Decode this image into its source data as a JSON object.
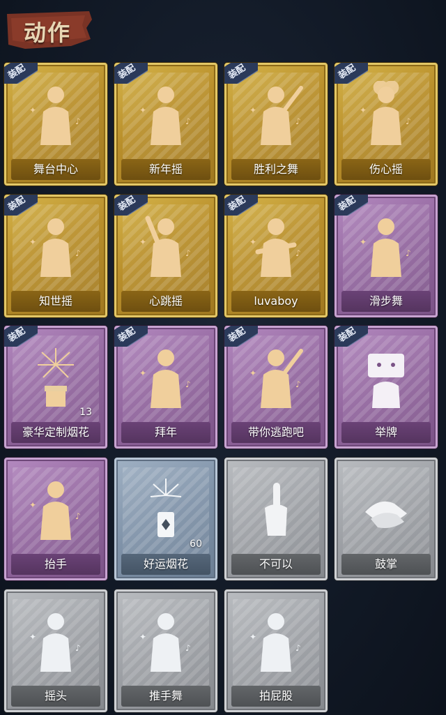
{
  "header": {
    "title": "动作"
  },
  "badge_text": "装配",
  "colors": {
    "gold": "#c9a23d",
    "purple": "#9a6fa6",
    "blue": "#8597ad",
    "gray": "#a2a5aa",
    "badge": "#2b3a5a",
    "background": "#151d2a"
  },
  "cards": [
    {
      "label": "舞台中心",
      "rarity": "gold",
      "equipped": true,
      "icon": "pose-hand-on-chest-icon"
    },
    {
      "label": "新年摇",
      "rarity": "gold",
      "equipped": true,
      "icon": "pose-shake-icon"
    },
    {
      "label": "胜利之舞",
      "rarity": "gold",
      "equipped": true,
      "icon": "pose-victory-dance-icon"
    },
    {
      "label": "伤心摇",
      "rarity": "gold",
      "equipped": true,
      "icon": "pose-heart-arms-icon"
    },
    {
      "label": "知世摇",
      "rarity": "gold",
      "equipped": true,
      "icon": "pose-arm-wave-icon"
    },
    {
      "label": "心跳摇",
      "rarity": "gold",
      "equipped": true,
      "icon": "pose-hand-raise-icon"
    },
    {
      "label": "luvaboy",
      "rarity": "gold",
      "equipped": true,
      "icon": "pose-cross-arms-icon"
    },
    {
      "label": "滑步舞",
      "rarity": "purple",
      "equipped": true,
      "icon": "pose-slide-icon"
    },
    {
      "label": "豪华定制烟花",
      "rarity": "purple",
      "equipped": true,
      "icon": "fireworks-box-icon",
      "count": "13"
    },
    {
      "label": "拜年",
      "rarity": "purple",
      "equipped": true,
      "icon": "pose-greeting-icon"
    },
    {
      "label": "带你逃跑吧",
      "rarity": "purple",
      "equipped": true,
      "icon": "pose-run-icon"
    },
    {
      "label": "举牌",
      "rarity": "purple",
      "equipped": true,
      "icon": "pose-hold-sign-icon"
    },
    {
      "label": "抬手",
      "rarity": "purple",
      "equipped": false,
      "icon": "pose-raise-hand-icon"
    },
    {
      "label": "好运烟花",
      "rarity": "blue",
      "equipped": false,
      "icon": "firecracker-icon",
      "count": "60"
    },
    {
      "label": "不可以",
      "rarity": "gray",
      "equipped": false,
      "icon": "finger-wag-icon"
    },
    {
      "label": "鼓掌",
      "rarity": "gray",
      "equipped": false,
      "icon": "clap-icon"
    },
    {
      "label": "摇头",
      "rarity": "gray",
      "equipped": false,
      "icon": "pose-head-shake-icon"
    },
    {
      "label": "推手舞",
      "rarity": "gray",
      "equipped": false,
      "icon": "pose-push-dance-icon"
    },
    {
      "label": "拍屁股",
      "rarity": "gray",
      "equipped": false,
      "icon": "pose-spank-icon"
    }
  ]
}
